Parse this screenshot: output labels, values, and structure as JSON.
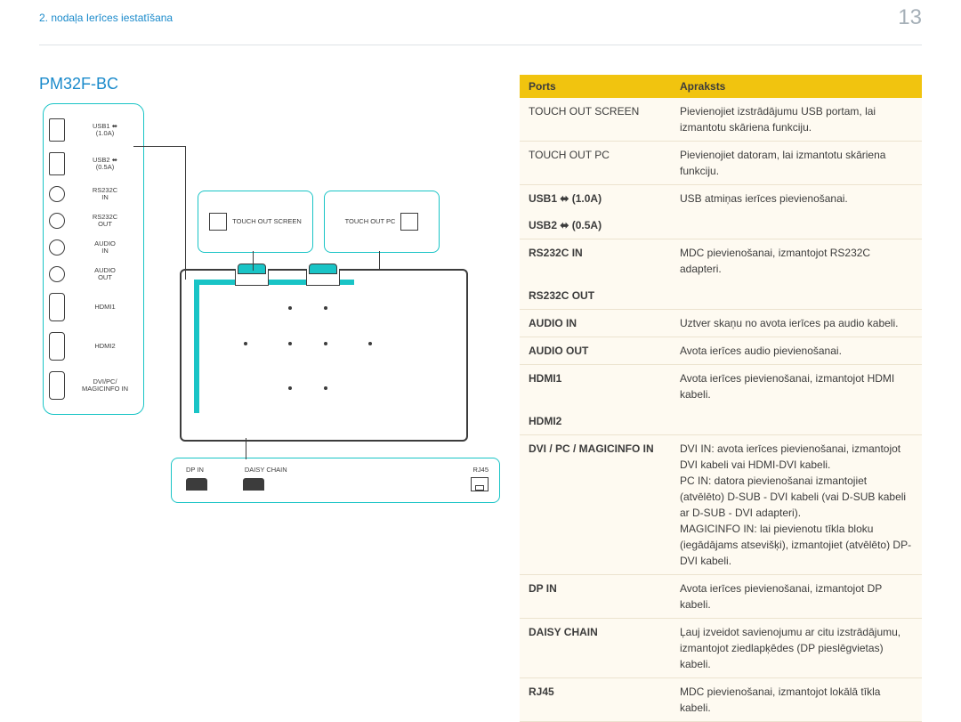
{
  "header": {
    "chapter": "2. nodaļa Ierīces iestatīšana",
    "page_no": "13"
  },
  "model": "PM32F-BC",
  "diagram": {
    "ports_panel": [
      {
        "shape": "usb",
        "label": "USB1 ⬌\n(1.0A)"
      },
      {
        "shape": "usb",
        "label": "USB2 ⬌\n(0.5A)"
      },
      {
        "shape": "circ",
        "label": "RS232C\nIN"
      },
      {
        "shape": "circ",
        "label": "RS232C\nOUT"
      },
      {
        "shape": "circ",
        "label": "AUDIO\nIN"
      },
      {
        "shape": "circ",
        "label": "AUDIO\nOUT"
      },
      {
        "shape": "trap",
        "label": "HDMI1"
      },
      {
        "shape": "trap",
        "label": "HDMI2"
      },
      {
        "shape": "trap",
        "label": "DVI/PC/\nMAGICINFO IN"
      }
    ],
    "touch_out": [
      {
        "label": "TOUCH OUT\nSCREEN"
      },
      {
        "label": "TOUCH OUT\nPC"
      }
    ],
    "bottom": {
      "labels": [
        "DP IN",
        "DAISY CHAIN",
        "",
        "RJ45"
      ],
      "rj45_label": "RJ45"
    }
  },
  "table": {
    "head": {
      "ports": "Ports",
      "desc": "Apraksts"
    },
    "rows": [
      {
        "port": "TOUCH OUT SCREEN",
        "bold": false,
        "desc": "Pievienojiet izstrādājumu USB portam, lai izmantotu skāriena funkciju."
      },
      {
        "port": "TOUCH OUT PC",
        "bold": false,
        "desc": "Pievienojiet datoram, lai izmantotu skāriena funkciju."
      },
      {
        "port": "USB1 ⬌ (1.0A)",
        "bold": true,
        "desc": "USB atmiņas ierīces pievienošanai.",
        "nosep": true
      },
      {
        "port": "USB2 ⬌ (0.5A)",
        "bold": true,
        "desc": ""
      },
      {
        "port": "RS232C IN",
        "bold": true,
        "desc": "MDC pievienošanai, izmantojot RS232C adapteri.",
        "nosep": true
      },
      {
        "port": "RS232C OUT",
        "bold": true,
        "desc": ""
      },
      {
        "port": "AUDIO IN",
        "bold": true,
        "desc": "Uztver skaņu no avota ierīces pa audio kabeli."
      },
      {
        "port": "AUDIO OUT",
        "bold": true,
        "desc": "Avota ierīces audio pievienošanai."
      },
      {
        "port": "HDMI1",
        "bold": true,
        "desc": "Avota ierīces pievienošanai, izmantojot HDMI kabeli.",
        "nosep": true
      },
      {
        "port": "HDMI2",
        "bold": true,
        "desc": ""
      },
      {
        "port": "DVI / PC / MAGICINFO IN",
        "bold": true,
        "desc": "DVI IN: avota ierīces pievienošanai, izmantojot DVI kabeli vai HDMI-DVI kabeli.\nPC IN: datora pievienošanai izmantojiet (atvēlēto) D-SUB - DVI kabeli (vai D-SUB kabeli ar D-SUB - DVI adapteri).\nMAGICINFO IN: lai pievienotu tīkla bloku (iegādājams atsevišķi), izmantojiet (atvēlēto) DP-DVI kabeli."
      },
      {
        "port": "DP IN",
        "bold": true,
        "desc": "Avota ierīces pievienošanai, izmantojot DP kabeli."
      },
      {
        "port": "DAISY CHAIN",
        "bold": true,
        "desc": "Ļauj izveidot savienojumu ar citu izstrādājumu, izmantojot ziedlapķēdes (DP pieslēgvietas) kabeli."
      },
      {
        "port": "RJ45",
        "bold": true,
        "desc": "MDC pievienošanai, izmantojot lokālā tīkla kabeli."
      }
    ]
  }
}
